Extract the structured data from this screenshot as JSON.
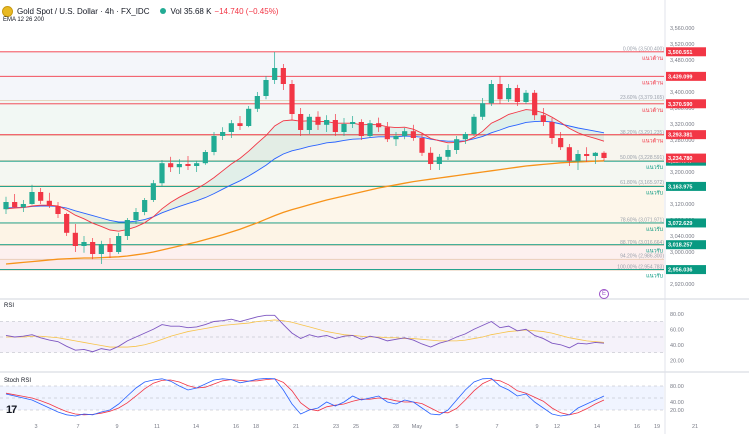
{
  "header": {
    "symbol": "Gold Spot / U.S. Dollar · 4h · FX_IDC",
    "volume": "Vol 35.68 K",
    "change": "−14.740 (−0.45%)",
    "indicator": "EMA 12 26 200"
  },
  "panes": {
    "rsi_label": "RSI",
    "stoch_label": "Stoch RSI",
    "logo": "17"
  },
  "colors": {
    "up": "#22ab94",
    "down": "#f23645",
    "ema12": "#f23645",
    "ema26": "#2962ff",
    "ema200": "#f7931a",
    "rsi": "#7e57c2",
    "rsi_ma": "#f7c34a",
    "stoch_k": "#2962ff",
    "stoch_d": "#f23645"
  },
  "chart_data": {
    "type": "candlestick",
    "price_axis": {
      "range": [
        2900,
        3580
      ],
      "ticks": [
        3560,
        3520,
        3480,
        3440,
        3400,
        3360,
        3320,
        3280,
        3240,
        3200,
        3160,
        3120,
        3080,
        3040,
        3000,
        2960,
        2920
      ]
    },
    "x_labels": [
      "3",
      "7",
      "9",
      "11",
      "14",
      "16",
      "18",
      "21",
      "23",
      "25",
      "28",
      "May",
      "5",
      "7",
      "9",
      "12",
      "14",
      "16",
      "19",
      "21"
    ],
    "candles": [
      [
        3107,
        3138,
        3095,
        3125
      ],
      [
        3125,
        3145,
        3110,
        3112
      ],
      [
        3112,
        3130,
        3100,
        3120
      ],
      [
        3120,
        3168,
        3118,
        3150
      ],
      [
        3150,
        3160,
        3120,
        3128
      ],
      [
        3128,
        3148,
        3110,
        3115
      ],
      [
        3115,
        3125,
        3085,
        3095
      ],
      [
        3095,
        3098,
        3040,
        3048
      ],
      [
        3048,
        3070,
        3000,
        3015
      ],
      [
        3015,
        3040,
        2998,
        3025
      ],
      [
        3025,
        3035,
        2982,
        2995
      ],
      [
        2995,
        3028,
        2970,
        3020
      ],
      [
        3020,
        3035,
        2985,
        3000
      ],
      [
        3000,
        3048,
        2995,
        3040
      ],
      [
        3040,
        3085,
        3030,
        3080
      ],
      [
        3080,
        3110,
        3070,
        3100
      ],
      [
        3100,
        3135,
        3092,
        3130
      ],
      [
        3130,
        3180,
        3125,
        3172
      ],
      [
        3172,
        3230,
        3165,
        3222
      ],
      [
        3222,
        3238,
        3200,
        3212
      ],
      [
        3212,
        3232,
        3195,
        3220
      ],
      [
        3220,
        3240,
        3205,
        3215
      ],
      [
        3215,
        3228,
        3200,
        3222
      ],
      [
        3222,
        3255,
        3218,
        3250
      ],
      [
        3250,
        3300,
        3242,
        3290
      ],
      [
        3290,
        3312,
        3280,
        3300
      ],
      [
        3300,
        3330,
        3285,
        3322
      ],
      [
        3322,
        3340,
        3305,
        3315
      ],
      [
        3315,
        3365,
        3312,
        3358
      ],
      [
        3358,
        3400,
        3350,
        3390
      ],
      [
        3390,
        3440,
        3382,
        3430
      ],
      [
        3430,
        3500,
        3420,
        3460
      ],
      [
        3460,
        3470,
        3405,
        3420
      ],
      [
        3420,
        3430,
        3330,
        3345
      ],
      [
        3345,
        3360,
        3290,
        3305
      ],
      [
        3305,
        3345,
        3295,
        3338
      ],
      [
        3338,
        3352,
        3305,
        3318
      ],
      [
        3318,
        3342,
        3300,
        3330
      ],
      [
        3330,
        3345,
        3290,
        3300
      ],
      [
        3300,
        3335,
        3290,
        3320
      ],
      [
        3320,
        3340,
        3310,
        3325
      ],
      [
        3325,
        3332,
        3280,
        3290
      ],
      [
        3290,
        3330,
        3285,
        3322
      ],
      [
        3322,
        3336,
        3300,
        3312
      ],
      [
        3312,
        3325,
        3275,
        3282
      ],
      [
        3282,
        3300,
        3265,
        3290
      ],
      [
        3290,
        3310,
        3282,
        3302
      ],
      [
        3302,
        3318,
        3278,
        3285
      ],
      [
        3285,
        3298,
        3240,
        3248
      ],
      [
        3248,
        3262,
        3205,
        3220
      ],
      [
        3220,
        3245,
        3205,
        3238
      ],
      [
        3238,
        3268,
        3230,
        3255
      ],
      [
        3255,
        3290,
        3245,
        3282
      ],
      [
        3282,
        3300,
        3270,
        3295
      ],
      [
        3295,
        3345,
        3290,
        3338
      ],
      [
        3338,
        3385,
        3330,
        3372
      ],
      [
        3372,
        3430,
        3365,
        3420
      ],
      [
        3420,
        3440,
        3370,
        3382
      ],
      [
        3382,
        3420,
        3375,
        3410
      ],
      [
        3410,
        3418,
        3365,
        3375
      ],
      [
        3375,
        3405,
        3370,
        3398
      ],
      [
        3398,
        3405,
        3330,
        3342
      ],
      [
        3342,
        3360,
        3315,
        3325
      ],
      [
        3325,
        3335,
        3270,
        3285
      ],
      [
        3285,
        3300,
        3255,
        3262
      ],
      [
        3262,
        3270,
        3215,
        3228
      ],
      [
        3228,
        3255,
        3205,
        3245
      ],
      [
        3245,
        3262,
        3225,
        3240
      ],
      [
        3240,
        3250,
        3220,
        3248
      ],
      [
        3248,
        3252,
        3228,
        3235
      ]
    ],
    "series": [
      {
        "name": "EMA 12",
        "values": [
          3108,
          3110,
          3111,
          3115,
          3117,
          3117,
          3115,
          3105,
          3092,
          3083,
          3072,
          3064,
          3055,
          3052,
          3056,
          3063,
          3073,
          3088,
          3108,
          3124,
          3137,
          3148,
          3158,
          3171,
          3186,
          3203,
          3220,
          3234,
          3252,
          3272,
          3291,
          3315,
          3328,
          3330,
          3327,
          3328,
          3326,
          3326,
          3322,
          3322,
          3322,
          3318,
          3319,
          3318,
          3313,
          3311,
          3312,
          3307,
          3297,
          3284,
          3278,
          3273,
          3274,
          3277,
          3287,
          3302,
          3322,
          3332,
          3344,
          3350,
          3356,
          3354,
          3348,
          3337,
          3324,
          3309,
          3298,
          3290,
          3284,
          3277
        ]
      },
      {
        "name": "EMA 26",
        "values": [
          3110,
          3111,
          3111,
          3114,
          3115,
          3115,
          3114,
          3110,
          3103,
          3097,
          3091,
          3085,
          3079,
          3075,
          3075,
          3077,
          3081,
          3088,
          3098,
          3106,
          3114,
          3121,
          3128,
          3136,
          3146,
          3157,
          3168,
          3178,
          3190,
          3203,
          3217,
          3233,
          3245,
          3253,
          3258,
          3264,
          3268,
          3273,
          3275,
          3279,
          3282,
          3283,
          3286,
          3288,
          3288,
          3288,
          3290,
          3289,
          3287,
          3282,
          3279,
          3277,
          3277,
          3278,
          3283,
          3289,
          3298,
          3305,
          3313,
          3318,
          3324,
          3326,
          3327,
          3325,
          3320,
          3315,
          3310,
          3306,
          3302,
          3298
        ]
      },
      {
        "name": "EMA 200",
        "values": [
          2970,
          2972,
          2974,
          2976,
          2978,
          2980,
          2982,
          2983,
          2984,
          2985,
          2985,
          2986,
          2987,
          2988,
          2990,
          2993,
          2996,
          3000,
          3005,
          3010,
          3015,
          3020,
          3025,
          3031,
          3037,
          3043,
          3050,
          3057,
          3065,
          3073,
          3082,
          3091,
          3099,
          3106,
          3112,
          3118,
          3124,
          3130,
          3135,
          3140,
          3145,
          3150,
          3155,
          3160,
          3164,
          3168,
          3172,
          3176,
          3179,
          3182,
          3185,
          3188,
          3191,
          3194,
          3197,
          3200,
          3203,
          3206,
          3209,
          3212,
          3215,
          3217,
          3219,
          3221,
          3223,
          3224,
          3225,
          3226,
          3227,
          3228
        ]
      }
    ],
    "horizontal_levels": [
      {
        "price": 3500.551,
        "label": "3,500.551",
        "zone": "แนวต้าน",
        "color": "#f23645"
      },
      {
        "price": 3439.099,
        "label": "3,439.099",
        "zone": "แนวต้าน",
        "color": "#f23645"
      },
      {
        "price": 3370.59,
        "label": "3,370.590",
        "zone": "แนวต้าน",
        "color": "#f23645"
      },
      {
        "price": 3293.381,
        "label": "3,293.381",
        "zone": "แนวต้าน",
        "color": "#f23645"
      },
      {
        "price": 3227.047,
        "label": "3,227.047",
        "zone": "แนวรับ",
        "color": "#089981"
      },
      {
        "price": 3163.975,
        "label": "3,163.975",
        "zone": "แนวรับ",
        "color": "#089981"
      },
      {
        "price": 3072.629,
        "label": "3,072.629",
        "zone": "แนวรับ",
        "color": "#089981"
      },
      {
        "price": 3018.257,
        "label": "3,018.257",
        "zone": "แนวรับ",
        "color": "#089981"
      },
      {
        "price": 2956.036,
        "label": "2,956.036",
        "zone": "แนวรับ",
        "color": "#089981"
      }
    ],
    "current_price": {
      "price": 3234.78,
      "label": "3,234.780"
    },
    "fib_levels": [
      {
        "price": 3500.4,
        "label": "0.00% (3,500.400)"
      },
      {
        "price": 3379.165,
        "label": "23.60% (3,379.165)"
      },
      {
        "price": 3291.235,
        "label": "38.20% (3,291.235)"
      },
      {
        "price": 3228.591,
        "label": "50.00% (3,228.591)"
      },
      {
        "price": 3165.972,
        "label": "61.80% (3,165.972)"
      },
      {
        "price": 3071.971,
        "label": "78.60% (3,071.971)"
      },
      {
        "price": 3016.664,
        "label": "88.70% (3,016.664)"
      },
      {
        "price": 2982.0,
        "label": "94.20% (2,986.300)"
      },
      {
        "price": 2954.783,
        "label": "100.00% (2,954.783)"
      }
    ],
    "rsi": {
      "ticks": [
        80,
        60,
        40,
        20
      ],
      "range": [
        10,
        90
      ],
      "values": [
        52,
        50,
        51,
        53,
        49,
        46,
        44,
        38,
        33,
        34,
        31,
        35,
        33,
        38,
        45,
        50,
        55,
        60,
        66,
        64,
        64,
        62,
        63,
        66,
        70,
        71,
        73,
        70,
        73,
        76,
        78,
        78,
        66,
        55,
        48,
        53,
        50,
        52,
        48,
        51,
        52,
        47,
        51,
        49,
        45,
        47,
        49,
        46,
        41,
        37,
        42,
        45,
        50,
        54,
        60,
        65,
        70,
        62,
        64,
        58,
        60,
        52,
        48,
        42,
        40,
        36,
        42,
        41,
        43,
        42
      ],
      "ma": [
        50,
        50,
        50,
        51,
        51,
        50,
        49,
        47,
        45,
        43,
        41,
        39,
        37,
        37,
        37,
        38,
        40,
        43,
        47,
        51,
        54,
        57,
        59,
        61,
        63,
        65,
        66,
        67,
        68,
        70,
        71,
        72,
        71,
        69,
        66,
        63,
        60,
        57,
        55,
        53,
        52,
        51,
        50,
        50,
        49,
        49,
        48,
        48,
        47,
        46,
        45,
        45,
        45,
        46,
        48,
        50,
        53,
        55,
        57,
        58,
        59,
        58,
        57,
        55,
        52,
        49,
        47,
        45,
        44,
        43
      ]
    },
    "stoch_rsi": {
      "ticks": [
        80,
        40,
        20
      ],
      "range": [
        -5,
        105
      ],
      "k": [
        60,
        55,
        50,
        45,
        35,
        25,
        15,
        8,
        5,
        10,
        8,
        15,
        20,
        35,
        55,
        75,
        90,
        95,
        98,
        92,
        80,
        70,
        75,
        85,
        95,
        98,
        96,
        88,
        92,
        97,
        99,
        98,
        70,
        35,
        10,
        20,
        25,
        40,
        30,
        40,
        55,
        45,
        50,
        55,
        40,
        35,
        45,
        40,
        25,
        10,
        8,
        20,
        45,
        70,
        90,
        98,
        99,
        80,
        70,
        55,
        60,
        40,
        25,
        10,
        5,
        8,
        25,
        35,
        45,
        55
      ],
      "d": [
        62,
        58,
        54,
        50,
        43,
        35,
        25,
        16,
        10,
        8,
        9,
        12,
        17,
        25,
        38,
        55,
        73,
        87,
        94,
        95,
        90,
        81,
        75,
        77,
        85,
        93,
        96,
        94,
        92,
        93,
        96,
        98,
        89,
        68,
        38,
        22,
        18,
        28,
        32,
        35,
        42,
        47,
        47,
        50,
        48,
        43,
        40,
        40,
        36,
        25,
        14,
        13,
        24,
        45,
        68,
        86,
        96,
        93,
        83,
        68,
        62,
        52,
        42,
        25,
        13,
        8,
        13,
        23,
        35,
        45
      ]
    }
  }
}
